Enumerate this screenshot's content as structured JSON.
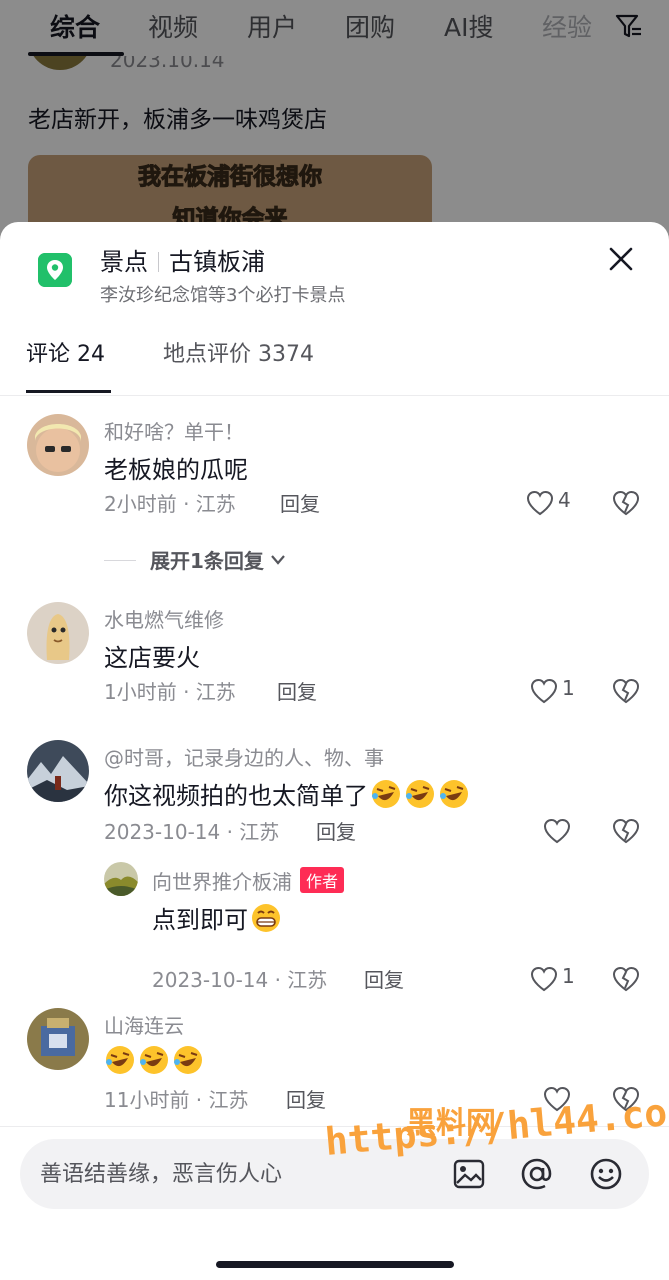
{
  "background_page": {
    "tabs": [
      "综合",
      "视频",
      "用户",
      "团购",
      "AI搜",
      "经验"
    ],
    "date": "2023.10.14",
    "post_title": "老店新开，板浦多一味鸡煲店",
    "video_caption_1": "我在板浦街很想你",
    "video_caption_2": "知道你会来"
  },
  "poi": {
    "category": "景点",
    "name": "古镇板浦",
    "subtitle": "李汝珍纪念馆等3个必打卡景点",
    "icon": "location-pin-icon"
  },
  "tabs": [
    {
      "label": "评论 24",
      "active": true
    },
    {
      "label": "地点评价 3374",
      "active": false
    }
  ],
  "comments": [
    {
      "user": "和好啥？单干！",
      "text": "老板娘的瓜呢",
      "meta": "2小时前 · 江苏",
      "reply": "回复",
      "likes": "4"
    },
    {
      "user": "水电燃气维修",
      "text": "这店要火",
      "meta": "1小时前 · 江苏",
      "reply": "回复",
      "likes": "1"
    },
    {
      "user": "@时哥，记录身边的人、物、事",
      "text": "你这视频拍的也太简单了",
      "meta": "2023-10-14 · 江苏",
      "reply": "回复",
      "likes": ""
    },
    {
      "user": "山海连云",
      "text": "",
      "meta": "11小时前 · 江苏",
      "reply": "回复",
      "likes": ""
    }
  ],
  "expand_replies": "展开1条回复",
  "author_reply": {
    "user": "向世界推介板浦",
    "badge": "作者",
    "text": "点到即可",
    "meta": "2023-10-14 · 江苏",
    "reply": "回复",
    "likes": "1"
  },
  "input": {
    "placeholder": "善语结善缘，恶言伤人心"
  },
  "watermark": {
    "line1": "黑料网",
    "line2": "https://hl44.co"
  },
  "colors": {
    "accent_red": "#fe2c55",
    "poi_green": "#21c06a",
    "watermark_orange": "#f9a23c"
  }
}
